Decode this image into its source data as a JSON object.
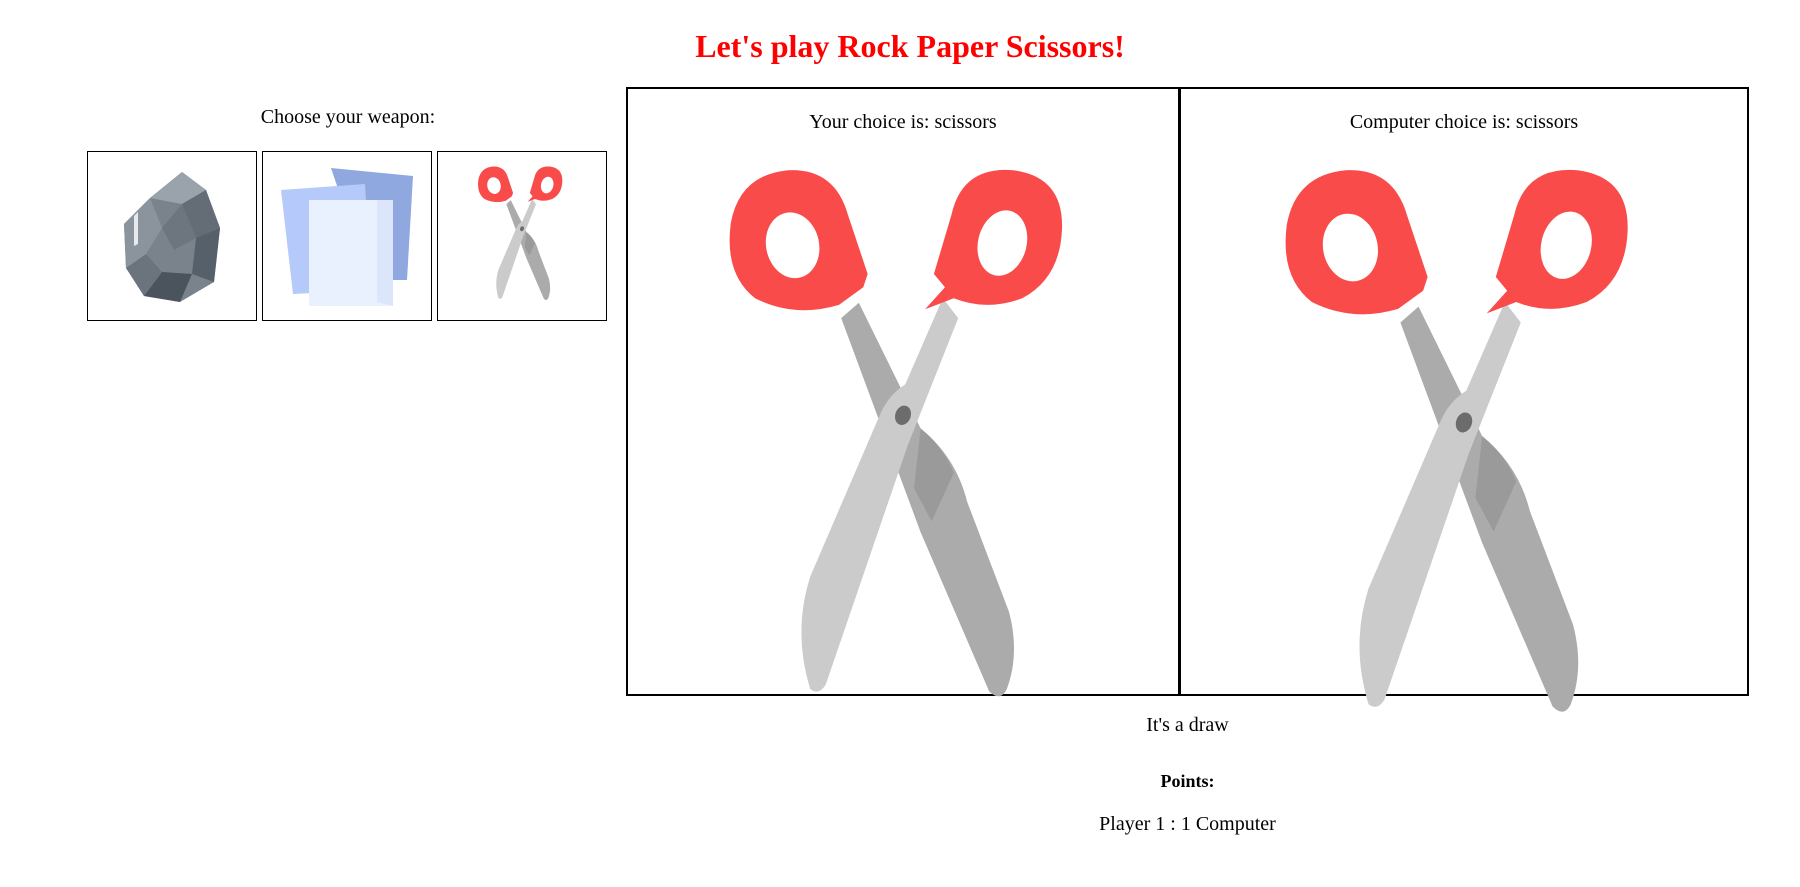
{
  "header": {
    "title": "Let's play Rock Paper Scissors!"
  },
  "weapons": {
    "label": "Choose your weapon:",
    "items": [
      {
        "name": "rock",
        "icon": "rock-icon"
      },
      {
        "name": "paper",
        "icon": "paper-icon"
      },
      {
        "name": "scissors",
        "icon": "scissors-icon"
      }
    ]
  },
  "arena": {
    "player": {
      "label": "Your choice is: scissors",
      "icon": "scissors-icon"
    },
    "computer": {
      "label": "Computer choice is: scissors",
      "icon": "scissors-icon"
    }
  },
  "result": {
    "text": "It's a draw"
  },
  "points": {
    "title": "Points:",
    "score_line": "Player 1 : 1 Computer"
  },
  "colors": {
    "title": "#ff0000",
    "scissors_handle": "#fa4b4b",
    "blade_light": "#cbcbcb",
    "blade_dark": "#ababab"
  }
}
